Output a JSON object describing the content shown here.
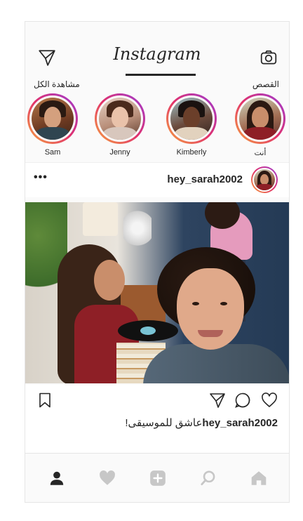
{
  "header": {
    "logo": "Instagram",
    "left_icon": "direct-message-icon",
    "right_icon": "camera-icon"
  },
  "stories": {
    "title": "القصص",
    "see_all": "مشاهدة الكل",
    "items": [
      {
        "name": "Sam"
      },
      {
        "name": "Jenny"
      },
      {
        "name": "Kimberly"
      },
      {
        "name": "أنت"
      }
    ]
  },
  "post": {
    "username": "hey_sarah2002",
    "more": "•••",
    "caption_user": "hey_sarah2002",
    "caption_text": "عاشق للموسيقى!"
  },
  "actions": {
    "icons": [
      "bookmark-icon",
      "share-icon",
      "comment-icon",
      "like-icon"
    ]
  },
  "bottom_nav": {
    "icons": [
      "profile-icon",
      "activity-heart-icon",
      "new-post-icon",
      "search-icon",
      "home-icon"
    ]
  },
  "colors": {
    "story_ring_start": "#f6a53c",
    "story_ring_mid": "#e1306c",
    "story_ring_end": "#9b3bd6",
    "active_icon": "#262626",
    "inactive_icon": "#c7c7c7"
  }
}
